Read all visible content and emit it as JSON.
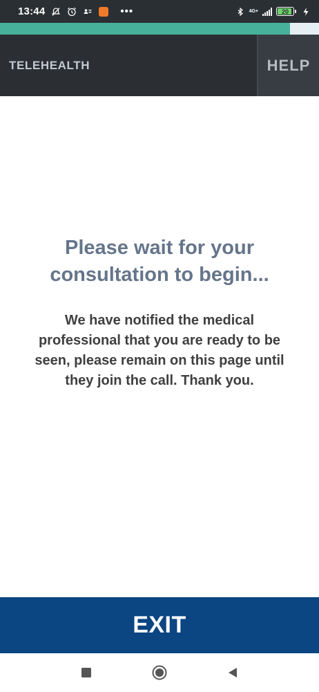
{
  "status_bar": {
    "time": "13:44",
    "network": "4G+",
    "battery_percent": "20",
    "overflow": "•••",
    "icons": [
      "silent-alarm-icon",
      "alarm-clock-icon",
      "contacts-icon",
      "app-notification-icon",
      "bluetooth-icon",
      "signal-icon",
      "battery-icon",
      "charging-icon"
    ]
  },
  "progress": {
    "value": 0.91,
    "color": "#48b19b"
  },
  "header": {
    "title": "TELEHEALTH",
    "help_label": "HELP"
  },
  "main": {
    "heading": "Please wait for your consultation to begin...",
    "message": "We have notified the medical professional that you are ready to be seen, please remain on this page until they join the call. Thank you."
  },
  "exit": {
    "label": "EXIT"
  },
  "nav_bar": {
    "icons": [
      "recent-apps-icon",
      "home-icon",
      "back-icon"
    ]
  },
  "colors": {
    "header_bg": "#2b2e33",
    "exit_bg": "#0b4582",
    "heading_text": "#65758a"
  }
}
